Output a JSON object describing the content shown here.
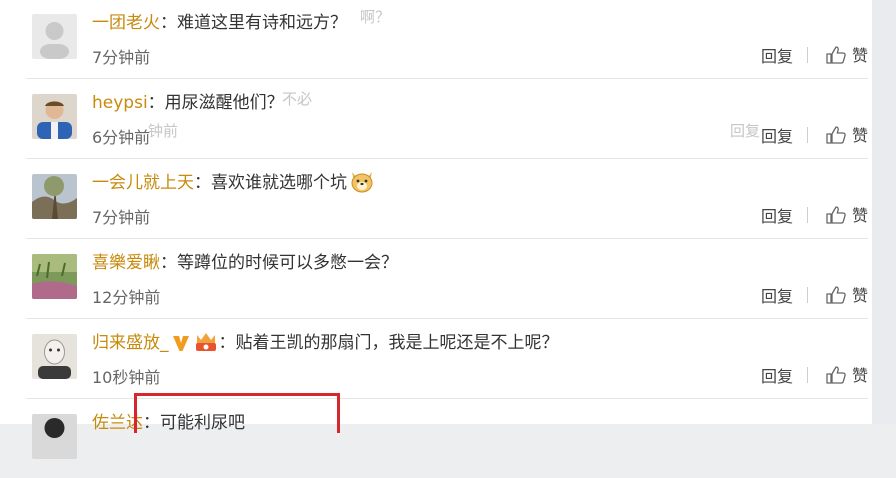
{
  "comments": [
    {
      "user": "一团老火",
      "text": "：难道这里有诗和远方？",
      "time": "7分钟前"
    },
    {
      "user": "heypsi",
      "text": "：用尿滋醒他们？",
      "time": "6分钟前"
    },
    {
      "user": "一会儿就上天",
      "text": "：喜欢谁就选哪个坑",
      "time": "7分钟前"
    },
    {
      "user": "喜樂爱瞅",
      "text": "：等蹲位的时候可以多憋一会？",
      "time": "12分钟前"
    },
    {
      "user": "归来盛放_",
      "text": "：贴着王凯的那扇门，我是上呢还是不上呢？",
      "time": "10秒钟前"
    },
    {
      "user": "佐兰达",
      "text": "：可能利尿吧",
      "time": ""
    }
  ],
  "actions": {
    "reply": "回复",
    "like": "赞"
  },
  "ghost": {
    "top_text": "啊？",
    "mid_text": "不必",
    "mid_time": "钟前",
    "mid_reply": "回复"
  },
  "colors": {
    "username": "#c78a0c",
    "highlight": "#d6262e"
  }
}
